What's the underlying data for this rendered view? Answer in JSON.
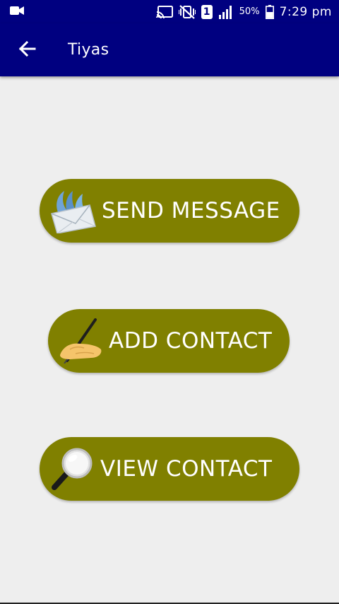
{
  "status_bar": {
    "battery_percent": "50%",
    "sim_slot": "1",
    "time": "7:29 pm",
    "icons": [
      "video-camera-icon",
      "cast-icon",
      "vibrate-mute-icon",
      "sim-icon",
      "signal-icon",
      "battery-icon"
    ]
  },
  "app_bar": {
    "title": "Tiyas",
    "back_icon": "arrow-left-icon",
    "background": "#000080"
  },
  "actions": {
    "send_message": {
      "label": "SEND MESSAGE",
      "icon": "envelope-icon"
    },
    "add_contact": {
      "label": "ADD CONTACT",
      "icon": "writing-hand-icon"
    },
    "view_contact": {
      "label": "VIEW CONTACT",
      "icon": "magnifier-icon"
    }
  },
  "colors": {
    "button": "#808000",
    "background": "#eeeeee",
    "text": "#ffffff"
  }
}
